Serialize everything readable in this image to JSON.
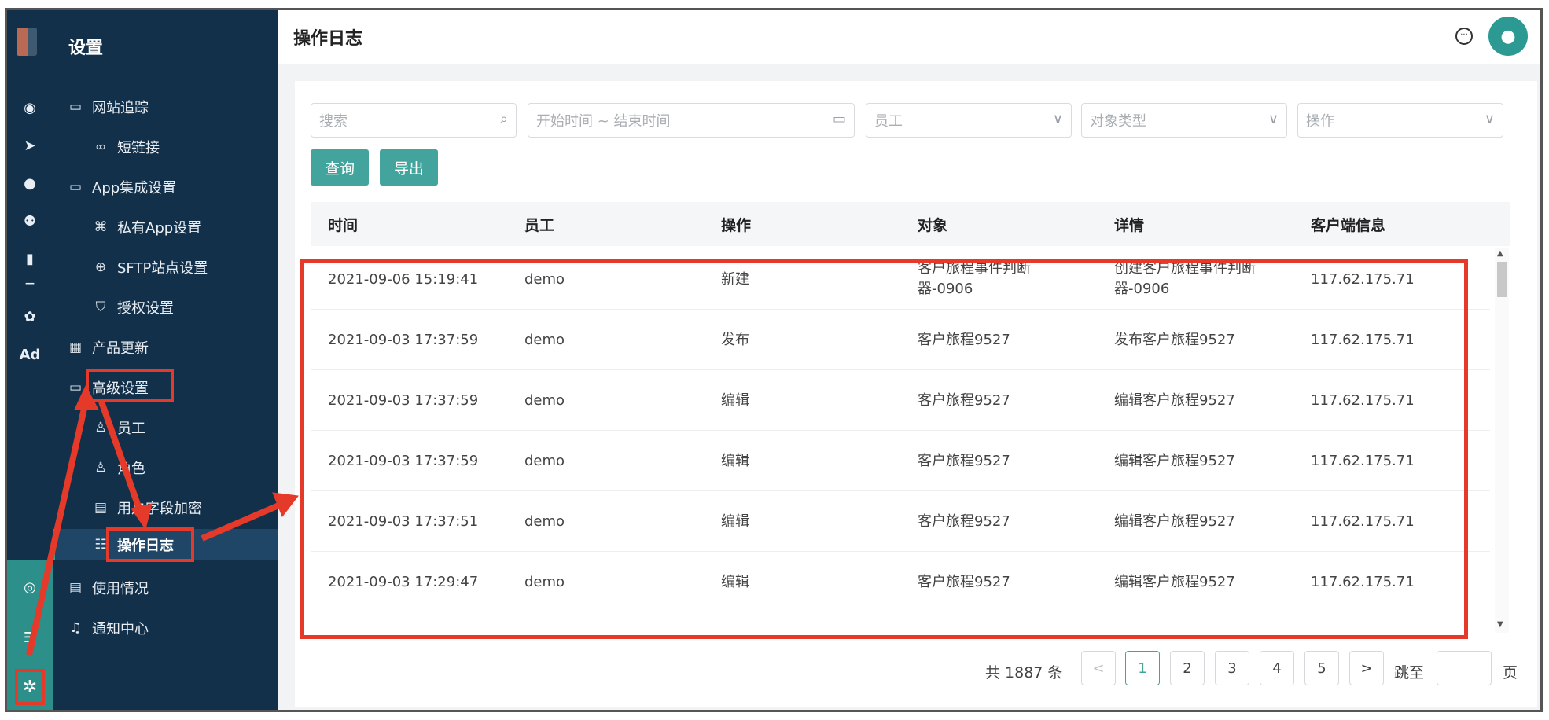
{
  "rail": {
    "icons": [
      "dashboard-icon",
      "send-icon",
      "user-icon",
      "users-icon",
      "bar-chart-icon",
      "wechat-icon",
      "Ad"
    ],
    "bottom_icons": [
      "circle-dot-icon",
      "server-icon",
      "gear-icon"
    ]
  },
  "sidebar": {
    "title": "设置",
    "items": [
      {
        "label": "网站追踪",
        "icon": "folder-icon"
      },
      {
        "label": "短链接",
        "icon": "link-icon"
      },
      {
        "label": "App集成设置",
        "icon": "folder-icon"
      },
      {
        "label": "私有App设置",
        "icon": "app-icon"
      },
      {
        "label": "SFTP站点设置",
        "icon": "globe-icon"
      },
      {
        "label": "授权设置",
        "icon": "shield-icon"
      },
      {
        "label": "产品更新",
        "icon": "grid-icon"
      },
      {
        "label": "高级设置",
        "icon": "folder-icon"
      },
      {
        "label": "员工",
        "icon": "person-icon"
      },
      {
        "label": "角色",
        "icon": "role-icon"
      },
      {
        "label": "用户字段加密",
        "icon": "lock-doc-icon"
      },
      {
        "label": "操作日志",
        "icon": "log-icon"
      },
      {
        "label": "使用情况",
        "icon": "usage-icon"
      },
      {
        "label": "通知中心",
        "icon": "bell-icon"
      }
    ]
  },
  "header": {
    "title": "操作日志"
  },
  "filters": {
    "search_placeholder": "搜索",
    "date_placeholder": "开始时间 ~ 结束时间",
    "employee_placeholder": "员工",
    "object_type_placeholder": "对象类型",
    "action_placeholder": "操作"
  },
  "buttons": {
    "query": "查询",
    "export": "导出"
  },
  "table": {
    "columns": [
      "时间",
      "员工",
      "操作",
      "对象",
      "详情",
      "客户端信息"
    ],
    "rows": [
      {
        "time": "2021-09-06 15:19:41",
        "employee": "demo",
        "action": "新建",
        "object": "客户旅程事件判断器-0906",
        "detail": "创建客户旅程事件判断器-0906",
        "client": "117.62.175.71"
      },
      {
        "time": "2021-09-03 17:37:59",
        "employee": "demo",
        "action": "发布",
        "object": "客户旅程9527",
        "detail": "发布客户旅程9527",
        "client": "117.62.175.71"
      },
      {
        "time": "2021-09-03 17:37:59",
        "employee": "demo",
        "action": "编辑",
        "object": "客户旅程9527",
        "detail": "编辑客户旅程9527",
        "client": "117.62.175.71"
      },
      {
        "time": "2021-09-03 17:37:59",
        "employee": "demo",
        "action": "编辑",
        "object": "客户旅程9527",
        "detail": "编辑客户旅程9527",
        "client": "117.62.175.71"
      },
      {
        "time": "2021-09-03 17:37:51",
        "employee": "demo",
        "action": "编辑",
        "object": "客户旅程9527",
        "detail": "编辑客户旅程9527",
        "client": "117.62.175.71"
      },
      {
        "time": "2021-09-03 17:29:47",
        "employee": "demo",
        "action": "编辑",
        "object": "客户旅程9527",
        "detail": "编辑客户旅程9527",
        "client": "117.62.175.71"
      }
    ]
  },
  "pagination": {
    "total": "共 1887 条",
    "prev": "<",
    "pages": [
      "1",
      "2",
      "3",
      "4",
      "5"
    ],
    "current": "1",
    "next": ">",
    "jump_label": "跳至",
    "page_suffix": "页"
  },
  "colors": {
    "accent": "#42a49c",
    "annotation": "#e53a2a",
    "sidebar_bg": "#13304a"
  }
}
